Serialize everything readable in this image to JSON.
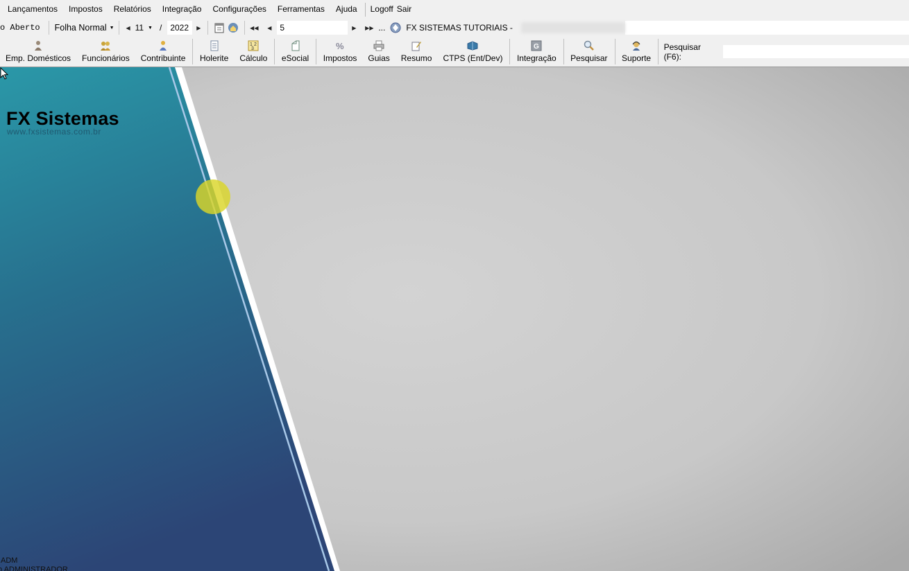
{
  "menu": {
    "items": [
      "Lançamentos",
      "Impostos",
      "Relatórios",
      "Integração",
      "Configurações",
      "Ferramentas",
      "Ajuda"
    ],
    "logoff": "Logoff",
    "exit": "Sair"
  },
  "period": {
    "status": "o Aberto",
    "payroll_type": "Folha Normal",
    "month": "11",
    "separator": "/",
    "year": "2022",
    "company_code": "5",
    "ellipsis": "...",
    "company_name": "FX SISTEMAS TUTORIAIS -"
  },
  "toolbar": {
    "buttons": [
      {
        "label": "Emp. Domésticos",
        "icon": "domestic-employer-icon"
      },
      {
        "label": "Funcionários",
        "icon": "employees-icon"
      },
      {
        "label": "Contribuinte",
        "icon": "contributor-icon"
      },
      {
        "label": "Holerite",
        "icon": "payslip-icon"
      },
      {
        "label": "Cálculo",
        "icon": "calculator-icon"
      },
      {
        "label": "eSocial",
        "icon": "esocial-icon"
      },
      {
        "label": "Impostos",
        "icon": "taxes-icon"
      },
      {
        "label": "Guias",
        "icon": "printer-icon"
      },
      {
        "label": "Resumo",
        "icon": "summary-icon"
      },
      {
        "label": "CTPS (Ent/Dev)",
        "icon": "ctps-icon"
      },
      {
        "label": "Integração",
        "icon": "integration-icon"
      },
      {
        "label": "Pesquisar",
        "icon": "magnifier-icon"
      },
      {
        "label": "Suporte",
        "icon": "support-icon"
      }
    ],
    "search_label": "Pesquisar (F6):",
    "search_value": ""
  },
  "brand": {
    "title": "FX Sistemas",
    "url": "www.fxsistemas.com.br"
  },
  "status": {
    "user": "ADM",
    "name": "o ADMINISTRADOR"
  },
  "colors": {
    "panel_top": "#2a98a8",
    "panel_bottom": "#2c4576",
    "background_light": "#d0d0d0",
    "background_dark": "#acacac",
    "cursor_highlight": "#dad628"
  }
}
